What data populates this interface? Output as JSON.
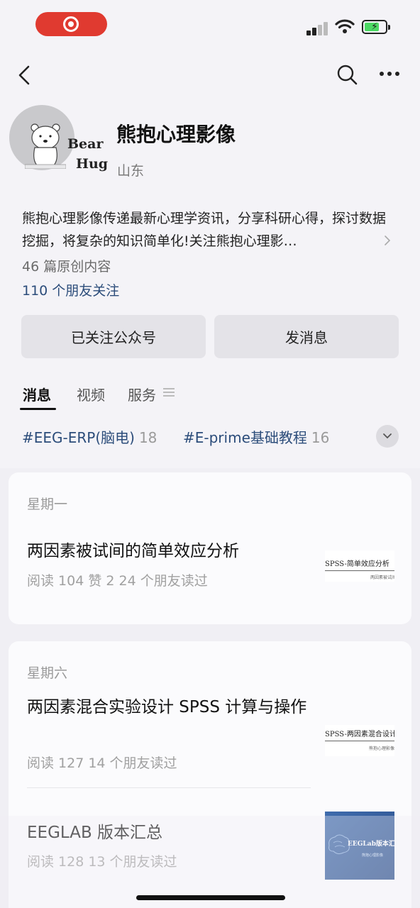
{
  "status": {
    "battery_color": "#4cd964",
    "record_color": "#e03a30"
  },
  "profile": {
    "avatar_text_1": "Bear",
    "avatar_text_2": "Hug",
    "name": "熊抱心理影像",
    "location": "山东",
    "description": "熊抱心理影像传递最新心理学资讯，分享科研心得，探讨数据挖掘，将复杂的知识简单化!关注熊抱心理影…",
    "articles_count": "46 篇原创内容",
    "friends_following": "110 个朋友关注"
  },
  "actions": {
    "follow_label": "已关注公众号",
    "message_label": "发消息"
  },
  "tabs": [
    {
      "label": "消息"
    },
    {
      "label": "视频"
    },
    {
      "label": "服务"
    }
  ],
  "topics": [
    {
      "label": "#EEG-ERP(脑电)",
      "count": "18"
    },
    {
      "label": "#E-prime基础教程",
      "count": "16"
    }
  ],
  "feed": [
    {
      "day": "星期一",
      "articles": [
        {
          "title": "两因素被试间的简单效应分析",
          "stats": "阅读 104   赞 2   24 个朋友读过",
          "thumb_title": "SPSS-简单效应分析",
          "thumb_sub": "两因素被试间分析"
        }
      ]
    },
    {
      "day": "星期六",
      "articles": [
        {
          "title": "两因素混合实验设计 SPSS 计算与操作",
          "stats": "阅读 127   14 个朋友读过",
          "thumb_title": "SPSS-两因素混合设计",
          "thumb_sub": "熊抱心理影像"
        },
        {
          "title": "EEGLAB 版本汇总",
          "stats": "阅读 128   13 个朋友读过",
          "thumb_title": "EEGLab版本汇总",
          "thumb_sub": "熊抱心理影像"
        }
      ]
    }
  ]
}
